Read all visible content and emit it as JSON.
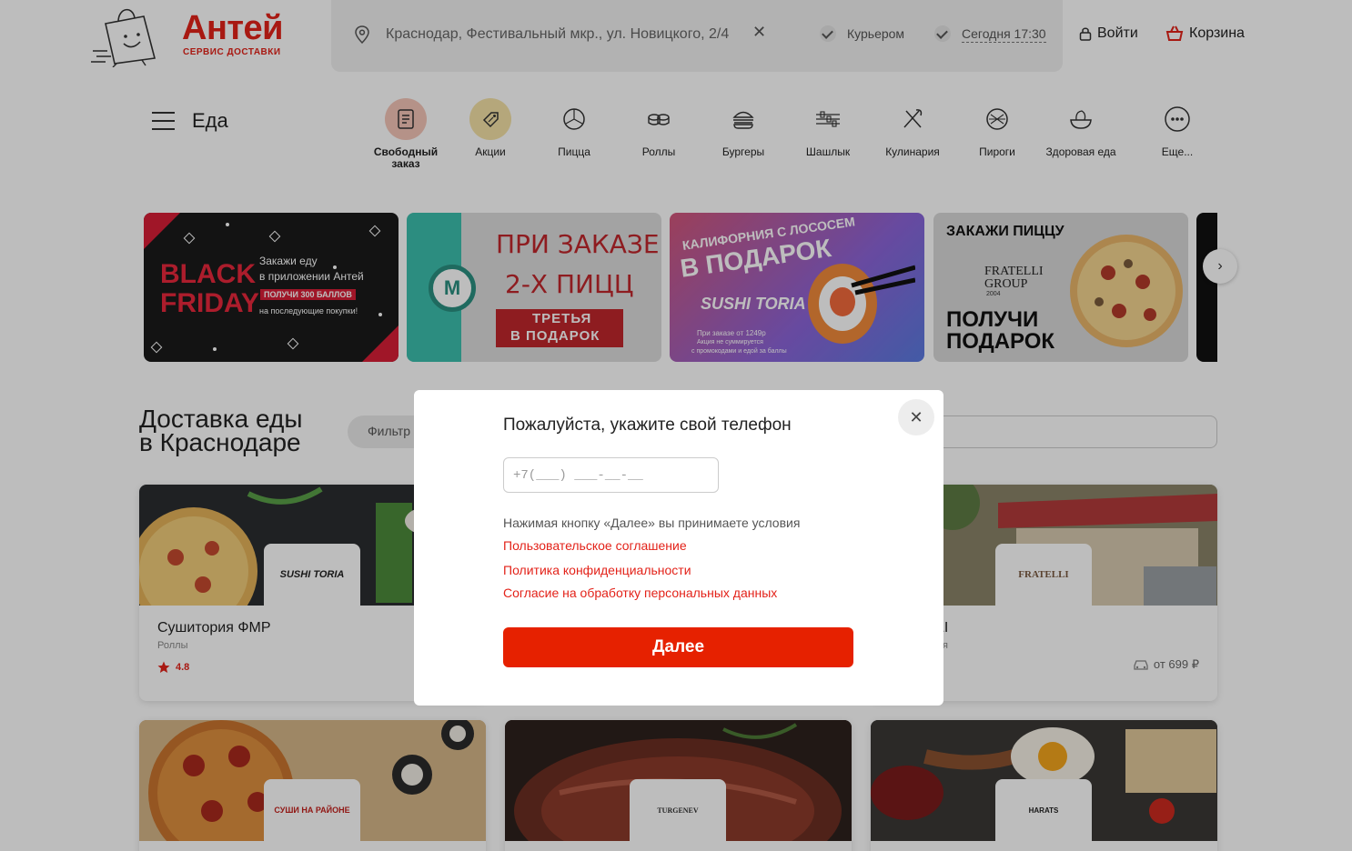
{
  "brand": {
    "name": "Антей",
    "subtitle": "СЕРВИС ДОСТАВКИ",
    "color": "#e32219"
  },
  "header": {
    "address": "Краснодар, Фестивальный мкр., ул. Новицкого, 2/4",
    "delivery_mode": "Курьером",
    "delivery_time": "Сегодня 17:30",
    "login_label": "Войти",
    "cart_label": "Корзина"
  },
  "nav": {
    "title": "Еда",
    "categories": [
      {
        "label": "Свободный заказ",
        "icon": "checklist-icon"
      },
      {
        "label": "Акции",
        "icon": "discount-tag-icon"
      },
      {
        "label": "Пицца",
        "icon": "pizza-icon"
      },
      {
        "label": "Роллы",
        "icon": "rolls-icon"
      },
      {
        "label": "Бургеры",
        "icon": "burger-icon"
      },
      {
        "label": "Шашлык",
        "icon": "skewer-icon"
      },
      {
        "label": "Кулинария",
        "icon": "cutlery-icon"
      },
      {
        "label": "Пироги",
        "icon": "pie-icon"
      },
      {
        "label": "Здоровая еда",
        "icon": "salad-icon"
      },
      {
        "label": "Еще...",
        "icon": "more-icon"
      }
    ]
  },
  "banners": [
    {
      "title": "BLACK FRIDAY",
      "line1": "Закажи еду",
      "line2": "в приложении Антей",
      "badge": "ПОЛУЧИ 300 БАЛЛОВ",
      "line3": "на последующие покупки!"
    },
    {
      "line1": "ПРИ ЗАКАЗЕ",
      "line2": "2-Х ПИЦЦ",
      "line3": "ТРЕТЬЯ",
      "line4": "В ПОДАРОК"
    },
    {
      "line1": "КАЛИФОРНИЯ С ЛОСОСЕМ",
      "line2": "В ПОДАРОК",
      "brand": "SUSHI TORIA",
      "note1": "При заказе от 1249р",
      "note2": "Акция не суммируется",
      "note3": "с промокодами и едой за баллы"
    },
    {
      "line1": "ЗАКАЖИ ПИЦЦУ",
      "brand": "FRATELLI GROUP",
      "year": "2004",
      "line2": "ПОЛУЧИ",
      "line3": "ПОДАРОК"
    }
  ],
  "section": {
    "title_line1": "Доставка еды",
    "title_line2": "в Краснодаре",
    "filter_label": "Фильтр"
  },
  "restaurants": [
    {
      "name": "Сушитория ФМР",
      "category": "Роллы",
      "rating": "4.8",
      "logo": "SUSHI TORIA"
    },
    {
      "name": "LI",
      "category": "я",
      "price": "от 699 ₽",
      "logo": "FRATELLI"
    },
    {
      "name": "",
      "category": "",
      "logo": "СУШИ НА РАЙОНЕ"
    },
    {
      "name": "",
      "category": "",
      "logo": "TURGENEV"
    },
    {
      "name": "",
      "category": "",
      "logo": "HARATS"
    }
  ],
  "modal": {
    "title": "Пожалуйста, укажите свой телефон",
    "phone_placeholder": "+7(___) ___-__-__",
    "terms_text": "Нажимая кнопку «Далее» вы принимаете условия",
    "links": [
      "Пользовательское соглашение",
      "Политика конфиденциальности",
      "Согласие на обработку персональных данных"
    ],
    "submit_label": "Далее",
    "accent_color": "#e62100"
  }
}
